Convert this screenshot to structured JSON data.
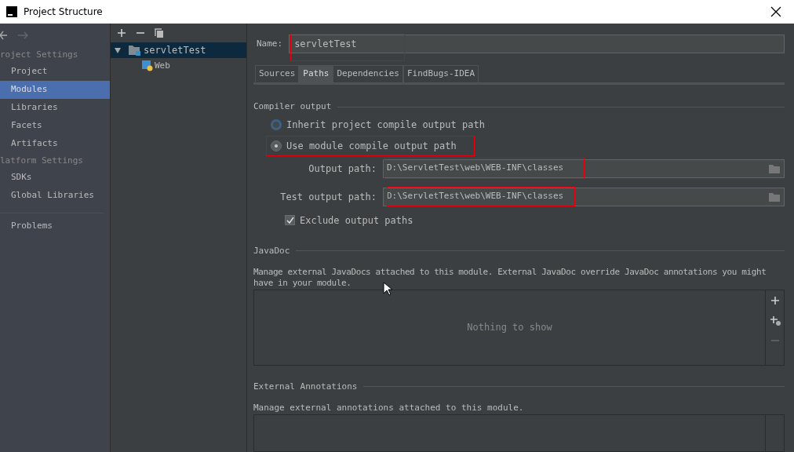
{
  "window": {
    "title": "Project Structure"
  },
  "sidebar": {
    "groups": [
      {
        "header": "roject Settings",
        "items": [
          {
            "label": "Project",
            "selected": false
          },
          {
            "label": "Modules",
            "selected": true
          },
          {
            "label": "Libraries",
            "selected": false
          },
          {
            "label": "Facets",
            "selected": false
          },
          {
            "label": "Artifacts",
            "selected": false
          }
        ]
      },
      {
        "header": "latform Settings",
        "items": [
          {
            "label": "SDKs",
            "selected": false
          },
          {
            "label": "Global Libraries",
            "selected": false
          }
        ]
      }
    ],
    "footer_items": [
      {
        "label": "Problems",
        "selected": false
      }
    ]
  },
  "module_tree": {
    "items": [
      {
        "label": "servletTest",
        "selected": true,
        "expanded": true,
        "children": [
          {
            "label": "Web",
            "selected": false
          }
        ]
      }
    ]
  },
  "name_field": {
    "label": "Name:",
    "value": "servletTest"
  },
  "tabs": [
    {
      "label": "Sources",
      "selected": false
    },
    {
      "label": "Paths",
      "selected": true
    },
    {
      "label": "Dependencies",
      "selected": false
    },
    {
      "label": "FindBugs-IDEA",
      "selected": false
    }
  ],
  "compiler_output": {
    "title": "Compiler output",
    "options": [
      {
        "label": "Inherit project compile output path",
        "selected": false
      },
      {
        "label": "Use module compile output path",
        "selected": true
      }
    ],
    "fields": [
      {
        "label": "Output path:",
        "value": "D:\\ServletTest\\web\\WEB-INF\\classes"
      },
      {
        "label": "Test output path:",
        "value": "D:\\ServletTest\\web\\WEB-INF\\classes"
      }
    ],
    "exclude": {
      "label": "Exclude output paths",
      "checked": true
    }
  },
  "javadoc": {
    "title": "JavaDoc",
    "description": "Manage external JavaDocs attached to this module. External JavaDoc override JavaDoc annotations you might have in your module.",
    "empty_text": "Nothing to show"
  },
  "external_annotations": {
    "title": "External Annotations",
    "description": "Manage external annotations attached to this module."
  }
}
